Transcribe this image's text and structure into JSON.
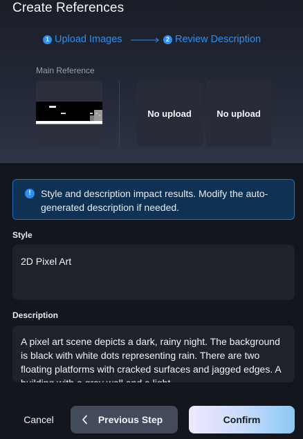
{
  "dialog": {
    "title": "Create References"
  },
  "steps": [
    {
      "number": "1",
      "label": "Upload Images"
    },
    {
      "number": "2",
      "label": "Review Description"
    }
  ],
  "references": {
    "main_label": "Main Reference",
    "slots": [
      {
        "label": "No upload"
      },
      {
        "label": "No upload"
      }
    ]
  },
  "info": {
    "icon": "info-icon",
    "text": "Style and description impact results. Modify the auto-generated description if needed."
  },
  "style": {
    "label": "Style",
    "value": "2D Pixel Art"
  },
  "description": {
    "label": "Description",
    "value": "A pixel art scene depicts a dark, rainy night. The background is black with white dots representing rain. There are two floating platforms with cracked surfaces and jagged edges. A building with a gray wall and a light"
  },
  "footer": {
    "cancel_label": "Cancel",
    "prev_label": "Previous Step",
    "confirm_label": "Confirm"
  },
  "colors": {
    "accent": "#2f8ff0",
    "banner_bg": "#0f3153",
    "banner_border": "#1f72c5",
    "field_bg": "#1e222b"
  }
}
